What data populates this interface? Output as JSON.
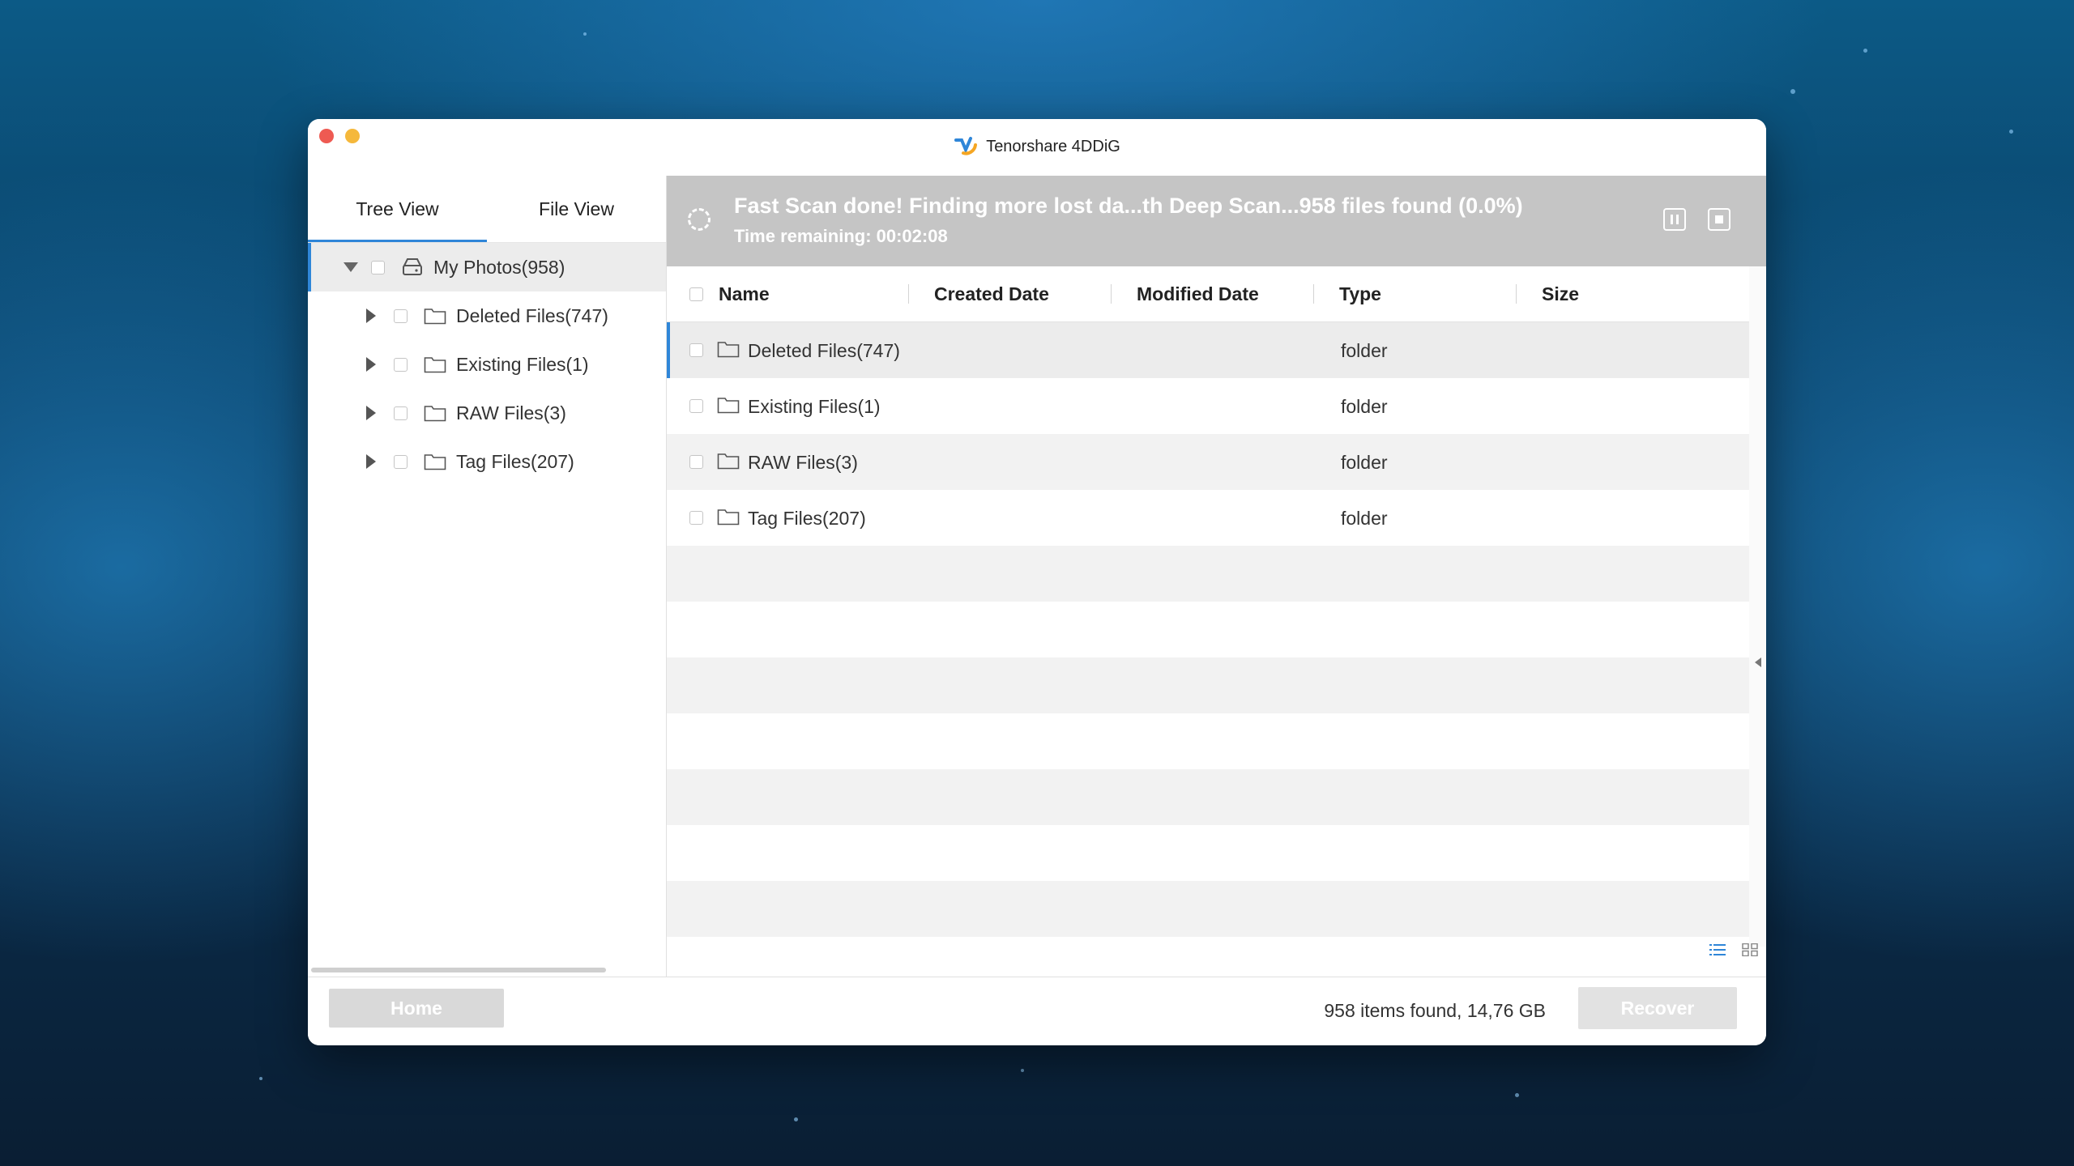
{
  "window": {
    "title": "Tenorshare 4DDiG"
  },
  "sidebar": {
    "tabs": [
      {
        "label": "Tree View",
        "active": true
      },
      {
        "label": "File View",
        "active": false
      }
    ],
    "root": {
      "label": "My Photos(958)",
      "icon": "drive-icon"
    },
    "items": [
      {
        "label": "Deleted Files(747)",
        "icon": "folder-icon"
      },
      {
        "label": "Existing Files(1)",
        "icon": "folder-icon"
      },
      {
        "label": "RAW Files(3)",
        "icon": "folder-icon"
      },
      {
        "label": "Tag Files(207)",
        "icon": "folder-icon"
      }
    ]
  },
  "scan": {
    "title": "Fast Scan done! Finding more lost da...th Deep Scan...958 files found (0.0%)",
    "time_remaining": "Time remaining: 00:02:08",
    "pause_icon": "pause-icon",
    "stop_icon": "stop-icon"
  },
  "table": {
    "columns": [
      "Name",
      "Created Date",
      "Modified Date",
      "Type",
      "Size"
    ],
    "rows": [
      {
        "name": "Deleted Files(747)",
        "type": "folder"
      },
      {
        "name": "Existing Files(1)",
        "type": "folder"
      },
      {
        "name": "RAW Files(3)",
        "type": "folder"
      },
      {
        "name": "Tag Files(207)",
        "type": "folder"
      }
    ]
  },
  "footer": {
    "home_label": "Home",
    "found_text": "958 items found, 14,76 GB",
    "recover_label": "Recover"
  },
  "colors": {
    "accent": "#2f86d8",
    "status_bar": "#c5c5c5",
    "close": "#ee5a52",
    "minimize": "#f5b83b"
  }
}
